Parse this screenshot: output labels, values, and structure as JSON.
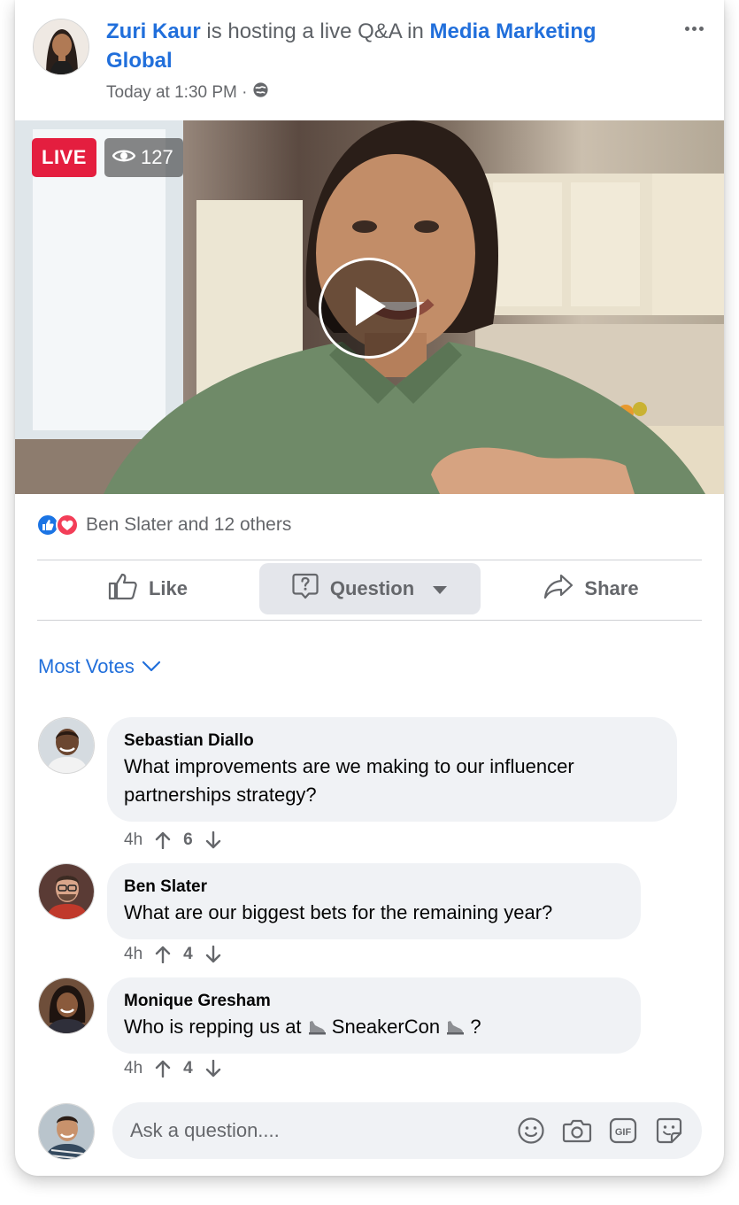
{
  "post": {
    "host_name": "Zuri Kaur",
    "host_action": " is hosting a live Q&A in ",
    "group_name": "Media Marketing Global",
    "timestamp": "Today at 1:30 PM ·"
  },
  "video": {
    "live_label": "LIVE",
    "viewer_count": "127"
  },
  "reactions": {
    "summary": "Ben Slater and 12 others"
  },
  "actions": {
    "like_label": "Like",
    "question_label": "Question",
    "share_label": "Share"
  },
  "sort": {
    "label": "Most Votes"
  },
  "questions": [
    {
      "author": "Sebastian Diallo",
      "text": "What improvements are we making to our influencer partnerships strategy?",
      "time": "4h",
      "votes": "6"
    },
    {
      "author": "Ben Slater",
      "text": "What are our biggest bets for the remaining year?",
      "time": "4h",
      "votes": "4"
    },
    {
      "author": "Monique Gresham",
      "text_before": "Who is repping us at ",
      "text_mid": " SneakerCon ",
      "text_after": " ?",
      "time": "4h",
      "votes": "4"
    }
  ],
  "compose": {
    "placeholder": "Ask a question...."
  },
  "colors": {
    "link_blue": "#216fdb",
    "live_red": "#e41e3f",
    "bubble_gray": "#f0f2f5",
    "meta_gray": "#65676b"
  },
  "icons": [
    "globe-icon",
    "eye-icon",
    "play-icon",
    "like-reaction-icon",
    "love-reaction-icon",
    "thumbs-up-icon",
    "question-icon",
    "caret-down-icon",
    "share-icon",
    "chevron-down-icon",
    "upvote-icon",
    "downvote-icon",
    "sneaker-icon",
    "emoji-icon",
    "camera-icon",
    "gif-icon",
    "sticker-icon",
    "more-icon"
  ]
}
